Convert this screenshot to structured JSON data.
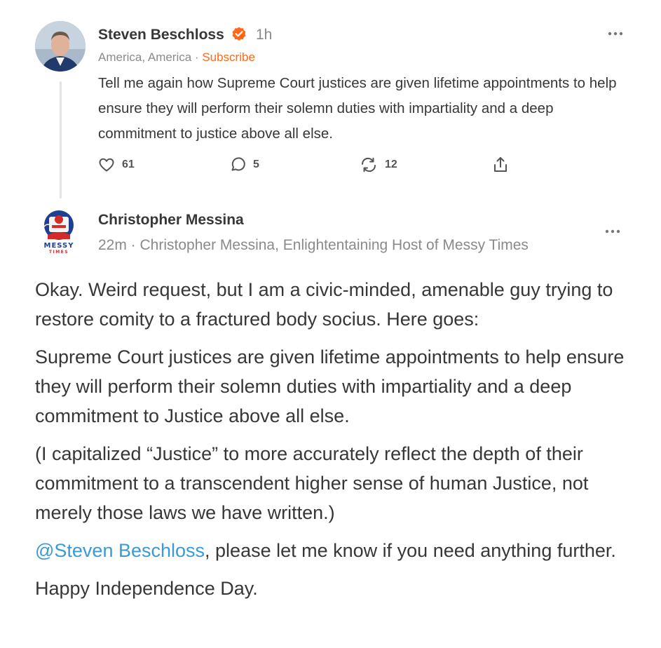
{
  "note1": {
    "author": "Steven Beschloss",
    "time": "1h",
    "location": "America, America",
    "separator": " · ",
    "subscribe": "Subscribe",
    "text": "Tell me again how Supreme Court justices are given lifetime appointments to help ensure they will perform their solemn duties with impartiality and a deep commitment to justice above all else.",
    "likes": "61",
    "comments": "5",
    "restacks": "12"
  },
  "note2": {
    "author": "Christopher Messina",
    "meta": "22m · Christopher Messina, Enlightentaining Host of Messy Times",
    "avatar_text": "MESSY",
    "avatar_subtext": "TIMES",
    "paragraphs": {
      "p1": "Okay.  Weird request, but I am a civic-minded, amenable guy trying to restore comity to a fractured body socius.  Here goes:",
      "p2": "Supreme Court justices are given lifetime appointments to help ensure they will perform their solemn duties with impartiality and a deep commitment to Justice above all else.",
      "p3": "(I capitalized “Justice” to more accurately reflect the depth of their commitment to a transcendent higher sense of human Justice, not merely those laws we have written.)",
      "p4_mention": "@Steven Beschloss",
      "p4_rest": ", please let me know if you need anything further.",
      "p5": "Happy Independence Day."
    }
  },
  "colors": {
    "accent": "#ff6719",
    "mention": "#3a9ad9",
    "text": "#363737",
    "muted": "#8a8a8a"
  },
  "icons": [
    "verified-badge-icon",
    "more-options-icon",
    "heart-icon",
    "comment-icon",
    "restack-icon",
    "share-icon"
  ]
}
